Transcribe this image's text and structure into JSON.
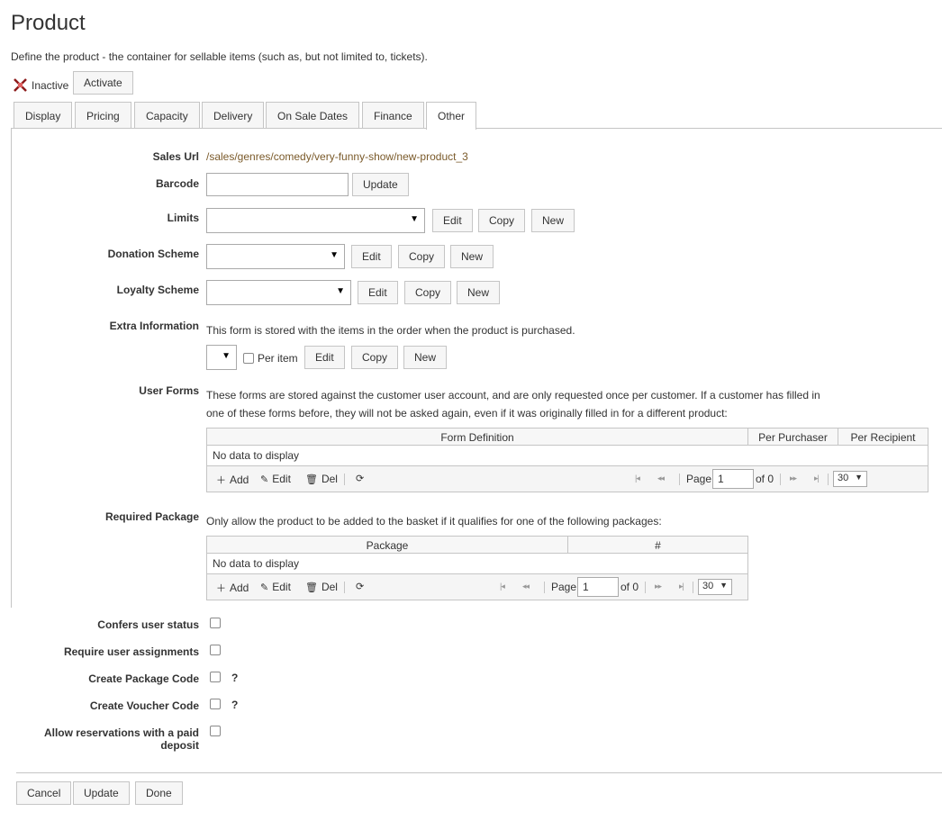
{
  "page": {
    "title": "Product",
    "description": "Define the product - the container for sellable items (such as, but not limited to, tickets)."
  },
  "status": {
    "text": "Inactive",
    "activate_label": "Activate"
  },
  "tabs": [
    "Display",
    "Pricing",
    "Capacity",
    "Delivery",
    "On Sale Dates",
    "Finance",
    "Other"
  ],
  "active_tab": "Other",
  "form": {
    "sales_url_label": "Sales Url",
    "sales_url_value": "/sales/genres/comedy/very-funny-show/new-product_3",
    "barcode_label": "Barcode",
    "barcode_value": "",
    "update_label": "Update",
    "limits_label": "Limits",
    "donation_label": "Donation Scheme",
    "loyalty_label": "Loyalty Scheme",
    "extra_info_label": "Extra Information",
    "extra_info_text": "This form is stored with the items in the order when the product is purchased.",
    "per_item_label": "Per item",
    "edit_label": "Edit",
    "copy_label": "Copy",
    "new_label": "New",
    "user_forms_label": "User Forms",
    "user_forms_text_1": "These forms are stored against the customer user account, and are only requested once per customer. If a customer has filled in",
    "user_forms_text_2": "one of these forms before, they will not be asked again, even if it was originally filled in for a different product:",
    "required_package_label": "Required Package",
    "required_package_text": "Only allow the product to be added to the basket if it qualifies for one of the following packages:",
    "confers_label": "Confers user status",
    "require_assign_label": "Require user assignments",
    "create_package_label": "Create Package Code",
    "create_voucher_label": "Create Voucher Code",
    "allow_res_label_1": "Allow reservations with a paid",
    "allow_res_label_2": "deposit",
    "help_mark": "?"
  },
  "user_forms_grid": {
    "columns": [
      "Form Definition",
      "Per Purchaser",
      "Per Recipient"
    ],
    "empty": "No data to display",
    "add": "Add",
    "edit": "Edit",
    "del": "Del",
    "page_label": "Page",
    "page_value": "1",
    "of": "of 0",
    "page_size": "30"
  },
  "package_grid": {
    "columns": [
      "Package",
      "#"
    ],
    "empty": "No data to display",
    "add": "Add",
    "edit": "Edit",
    "del": "Del",
    "page_label": "Page",
    "page_value": "1",
    "of": "of 0",
    "page_size": "30"
  },
  "footer": {
    "cancel": "Cancel",
    "update": "Update",
    "done": "Done"
  },
  "colors": {
    "link": "#7a5a2a",
    "border": "#c5c5c5",
    "button_bg": "#f6f6f6",
    "inactive_icon": "#8b1a1a"
  }
}
